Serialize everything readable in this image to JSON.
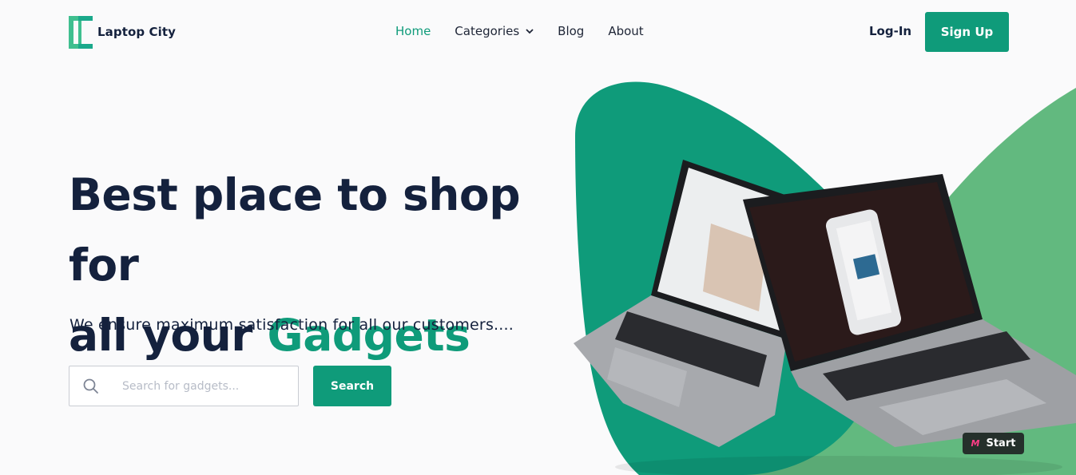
{
  "brand": {
    "name": "Laptop City",
    "primary_color": "#0f9b7a",
    "secondary_color": "#62b97f",
    "logo_icon": "laptop-city-logo-icon"
  },
  "nav": {
    "items": [
      {
        "label": "Home",
        "active": true
      },
      {
        "label": "Categories",
        "active": false,
        "icon": "chevron-down-icon"
      },
      {
        "label": "Blog",
        "active": false
      },
      {
        "label": "About",
        "active": false
      }
    ]
  },
  "auth": {
    "login_label": "Log-In",
    "signup_label": "Sign Up"
  },
  "hero": {
    "title_line1": "Best place to shop for",
    "title_line2_prefix": "all your ",
    "title_line2_accent": "Gadgets",
    "subtitle": "We ensure maximum satisfaction for all our customers...."
  },
  "search": {
    "placeholder": "Search for gadgets...",
    "value": "",
    "button_label": "Search",
    "icon": "search-icon"
  },
  "badge": {
    "label": "Start",
    "icon": "m-logo-icon"
  }
}
